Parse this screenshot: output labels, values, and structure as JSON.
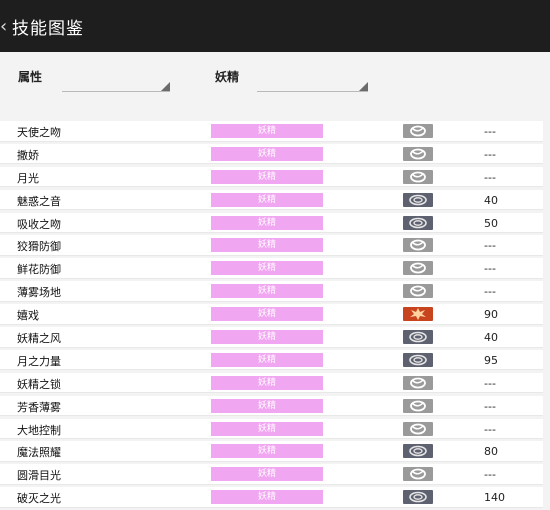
{
  "header": {
    "back_icon": "‹",
    "title": "技能图鉴"
  },
  "filters": {
    "attribute_label": "属性",
    "type_label": "妖精"
  },
  "moves": [
    {
      "name": "天使之吻",
      "type": "妖精",
      "category": "status",
      "power": "---"
    },
    {
      "name": "撒娇",
      "type": "妖精",
      "category": "status",
      "power": "---"
    },
    {
      "name": "月光",
      "type": "妖精",
      "category": "status",
      "power": "---"
    },
    {
      "name": "魅惑之音",
      "type": "妖精",
      "category": "special",
      "power": "40"
    },
    {
      "name": "吸收之吻",
      "type": "妖精",
      "category": "special",
      "power": "50"
    },
    {
      "name": "狡猾防御",
      "type": "妖精",
      "category": "status",
      "power": "---"
    },
    {
      "name": "鲜花防御",
      "type": "妖精",
      "category": "status",
      "power": "---"
    },
    {
      "name": "薄雾场地",
      "type": "妖精",
      "category": "status",
      "power": "---"
    },
    {
      "name": "嬉戏",
      "type": "妖精",
      "category": "physical",
      "power": "90"
    },
    {
      "name": "妖精之风",
      "type": "妖精",
      "category": "special",
      "power": "40"
    },
    {
      "name": "月之力量",
      "type": "妖精",
      "category": "special",
      "power": "95"
    },
    {
      "name": "妖精之锁",
      "type": "妖精",
      "category": "status",
      "power": "---"
    },
    {
      "name": "芳香薄雾",
      "type": "妖精",
      "category": "status",
      "power": "---"
    },
    {
      "name": "大地控制",
      "type": "妖精",
      "category": "status",
      "power": "---"
    },
    {
      "name": "魔法照耀",
      "type": "妖精",
      "category": "special",
      "power": "80"
    },
    {
      "name": "圆滑目光",
      "type": "妖精",
      "category": "status",
      "power": "---"
    },
    {
      "name": "破灭之光",
      "type": "妖精",
      "category": "special",
      "power": "140"
    }
  ],
  "colors": {
    "type_fairy": "#f0a6f0",
    "cat_status": "#9a9a9a",
    "cat_special": "#5e6270",
    "cat_physical": "#c8441e"
  },
  "icons": {
    "status": "status-swirl-icon",
    "special": "special-ring-icon",
    "physical": "physical-burst-icon"
  }
}
